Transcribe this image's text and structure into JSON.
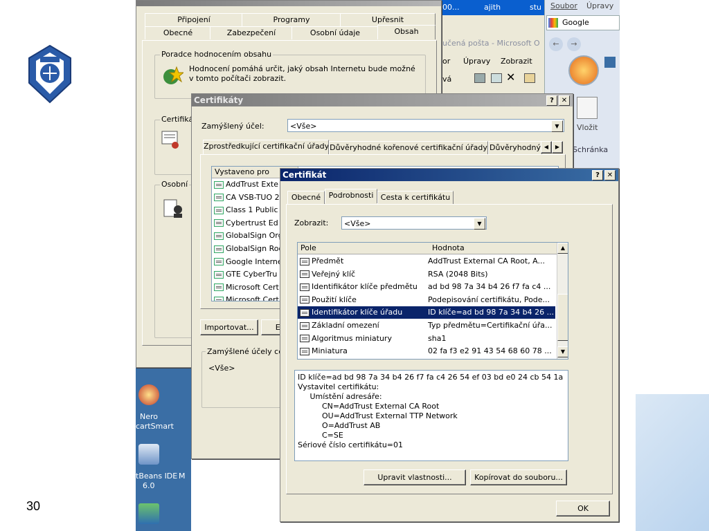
{
  "slide": {
    "page_number": "30"
  },
  "desktop": {
    "icons": [
      {
        "label1": "Nero",
        "label2": "cartSmart"
      },
      {
        "label1": "tBeans IDE",
        "label2": "6.0",
        "extra": "M"
      },
      {
        "label1": ""
      }
    ]
  },
  "outlook": {
    "top_items": [
      "00...",
      "ajith",
      "stu"
    ],
    "title_fragment": "učená pošta - Microsoft O",
    "menu": [
      "or",
      "Úpravy",
      "Zobrazit"
    ],
    "toolbar_fragment": "vá"
  },
  "browser_panel": {
    "menu": [
      "Soubor",
      "Úpravy"
    ],
    "search_label": "Google",
    "paste_label": "Vložit",
    "clipboard_label": "Schránka"
  },
  "internet_options": {
    "tabs_row1": [
      "Připojení",
      "Programy",
      "Upřesnit"
    ],
    "tabs_row2": [
      "Obecné",
      "Zabezpečení",
      "Osobní údaje",
      "Obsah"
    ],
    "content_advisor_group": "Poradce hodnocením obsahu",
    "content_advisor_text": "Hodnocení pomáhá určit, jaký obsah Internetu bude možné v tomto počítači zobrazit.",
    "certificates_group": "Certifiká",
    "personal_group": "Osobní"
  },
  "certificates": {
    "title": "Certifikáty",
    "purpose_label": "Zamýšlený účel:",
    "purpose_value": "<Vše>",
    "tabs": [
      "Zprostředkující certifikační úřady",
      "Důvěryhodné kořenové certifikační úřady",
      "Důvěryhodný"
    ],
    "column_issued_to": "Vystaveno pro",
    "rows": [
      "AddTrust Exte",
      "CA VSB-TUO 2",
      "Class 1 Public",
      "Cybertrust Ed",
      "GlobalSign Org",
      "GlobalSign Roo",
      "Google Interne",
      "GTE CyberTru",
      "Microsoft Cert",
      "Microsoft Cert"
    ],
    "import_button": "Importovat...",
    "export_button": "Exp",
    "purposes_group": "Zamýšlené účely cer",
    "purposes_value": "<Vše>"
  },
  "certificate": {
    "title": "Certifikát",
    "tabs": [
      "Obecné",
      "Podrobnosti",
      "Cesta k certifikátu"
    ],
    "show_label": "Zobrazit:",
    "show_value": "<Vše>",
    "columns": [
      "Pole",
      "Hodnota"
    ],
    "fields": [
      {
        "name": "Předmět",
        "value": "AddTrust External CA Root, A..."
      },
      {
        "name": "Veřejný klíč",
        "value": "RSA (2048 Bits)"
      },
      {
        "name": "Identifikátor klíče předmětu",
        "value": "ad bd 98 7a 34 b4 26 f7 fa c4 ..."
      },
      {
        "name": "Použití klíče",
        "value": "Podepisování certifikátu, Pode..."
      },
      {
        "name": "Identifikátor klíče úřadu",
        "value": "ID klíče=ad bd 98 7a 34 b4 26 ..."
      },
      {
        "name": "Základní omezení",
        "value": "Typ předmětu=Certifikační úřa..."
      },
      {
        "name": "Algoritmus miniatury",
        "value": "sha1"
      },
      {
        "name": "Miniatura",
        "value": "02 fa f3 e2 91 43 54 68 60 78 ..."
      }
    ],
    "selected_index": 4,
    "detail_lines": [
      "ID klíče=ad bd 98 7a 34 b4 26 f7 fa c4 26 54 ef 03 bd e0 24 cb 54 1a",
      "Vystavitel certifikátu:",
      "     Umístění adresáře:",
      "          CN=AddTrust External CA Root",
      "          OU=AddTrust External TTP Network",
      "          O=AddTrust AB",
      "          C=SE",
      "Sériové číslo certifikátu=01"
    ],
    "edit_properties_button": "Upravit vlastnosti...",
    "copy_to_file_button": "Kopírovat do souboru...",
    "ok_button": "OK",
    "help_button": "?",
    "close_button": "✕"
  },
  "colors": {
    "selection": "#0a246a",
    "dialog_face": "#ece9d8",
    "desktop_blue": "#3a6ea5"
  }
}
